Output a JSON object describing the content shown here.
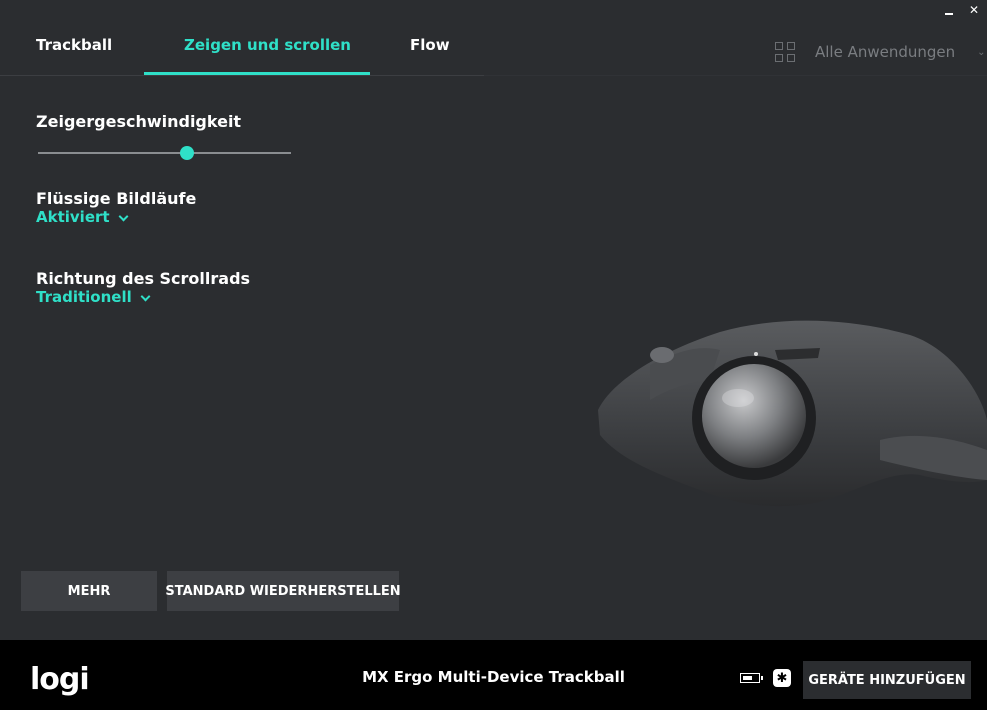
{
  "window": {
    "minimize_icon": "minimize-icon",
    "close_icon": "close-icon",
    "close_glyph": "✕"
  },
  "tabs": [
    {
      "label": "Trackball",
      "active": false
    },
    {
      "label": "Zeigen und scrollen",
      "active": true
    },
    {
      "label": "Flow",
      "active": false
    }
  ],
  "app_selector": {
    "label": "Alle Anwendungen",
    "icon": "grid-icon"
  },
  "settings": {
    "pointer_speed": {
      "title": "Zeigergeschwindigkeit",
      "value": 0.59
    },
    "smooth_scrolling": {
      "title": "Flüssige Bildläufe",
      "value": "Aktiviert"
    },
    "scroll_direction": {
      "title": "Richtung des Scrollrads",
      "value": "Traditionell"
    }
  },
  "buttons": {
    "more": "MEHR",
    "reset": "STANDARD WIEDERHERSTELLEN"
  },
  "footer": {
    "logo": "logi",
    "device_name": "MX Ergo Multi-Device Trackball",
    "battery_level": 0.6,
    "connection_icon": "bluetooth-icon",
    "add_devices": "GERÄTE HINZUFÜGEN"
  },
  "colors": {
    "accent": "#2fe0c8",
    "background": "#2b2d30",
    "footer": "#000000"
  }
}
